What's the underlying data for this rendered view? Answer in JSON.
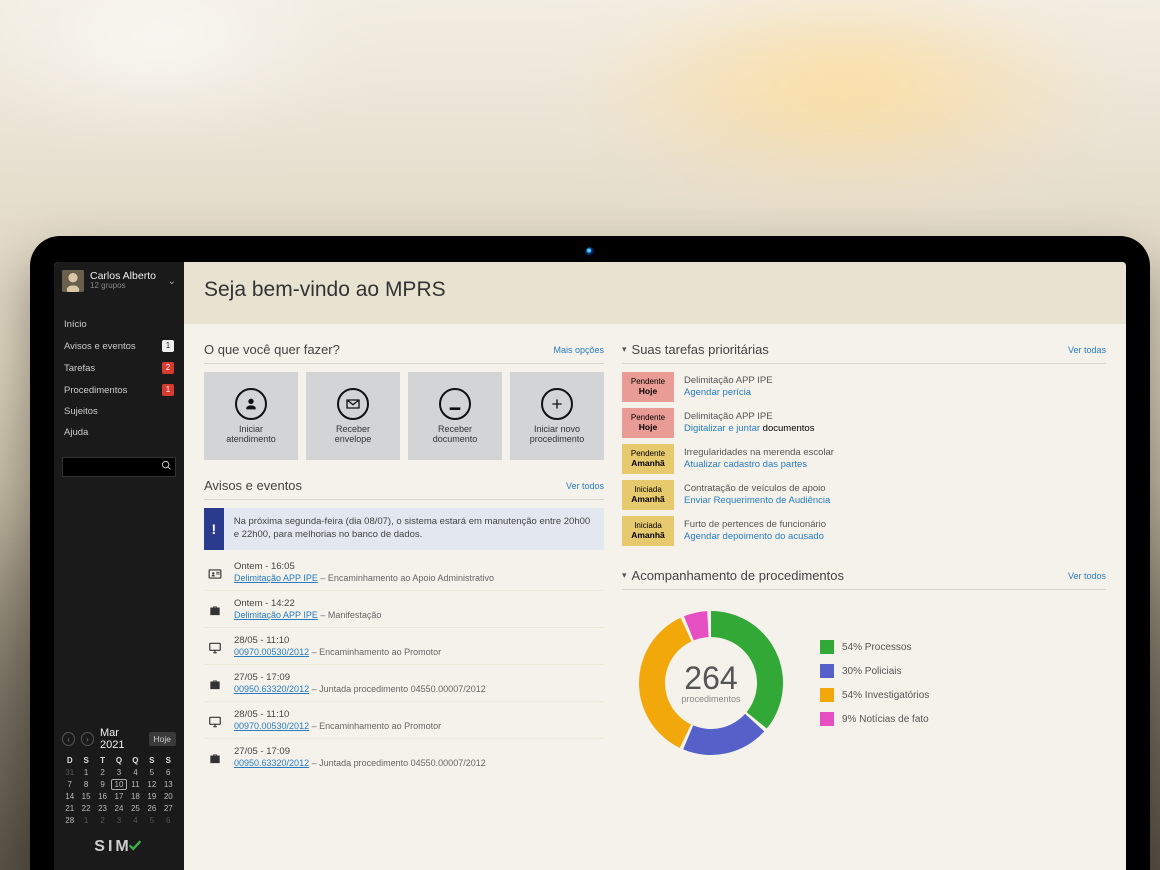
{
  "user": {
    "name": "Carlos Alberto",
    "subtitle": "12 grupos"
  },
  "nav": {
    "items": [
      {
        "label": "Início",
        "badge": "",
        "badge_class": ""
      },
      {
        "label": "Avisos e eventos",
        "badge": "1",
        "badge_class": "white"
      },
      {
        "label": "Tarefas",
        "badge": "2",
        "badge_class": "red"
      },
      {
        "label": "Procedimentos",
        "badge": "1",
        "badge_class": "red"
      },
      {
        "label": "Sujeitos",
        "badge": "",
        "badge_class": ""
      },
      {
        "label": "Ajuda",
        "badge": "",
        "badge_class": ""
      }
    ]
  },
  "search_placeholder": "",
  "calendar": {
    "title": "Mar 2021",
    "hoje": "Hoje",
    "weekdays": [
      "D",
      "S",
      "T",
      "Q",
      "Q",
      "S",
      "S"
    ],
    "leading_dim": [
      "31"
    ],
    "days": [
      "1",
      "2",
      "3",
      "4",
      "5",
      "6",
      "7",
      "8",
      "9",
      "10",
      "11",
      "12",
      "13",
      "14",
      "15",
      "16",
      "17",
      "18",
      "19",
      "20",
      "21",
      "22",
      "23",
      "24",
      "25",
      "26",
      "27",
      "28"
    ],
    "trailing_dim": [
      "1",
      "2",
      "3",
      "4",
      "5",
      "6"
    ],
    "today": "10"
  },
  "logo": "SIM",
  "page_title": "Seja bem-vindo ao MPRS",
  "quickactions": {
    "heading": "O que você quer fazer?",
    "more": "Mais opções",
    "tiles": [
      {
        "l1": "Iniciar",
        "l2": "atendimento"
      },
      {
        "l1": "Receber",
        "l2": "envelope"
      },
      {
        "l1": "Receber",
        "l2": "documento"
      },
      {
        "l1": "Iniciar novo",
        "l2": "procedimento"
      }
    ]
  },
  "avisos": {
    "heading": "Avisos e eventos",
    "more": "Ver todos",
    "notice": "Na próxima segunda-feira (dia 08/07), o sistema estará em manutenção entre 20h00 e 22h00, para melhorias no banco de dados.",
    "events": [
      {
        "icon": "id-card",
        "time": "Ontem - 16:05",
        "link": "Delimitação APP IPE",
        "suffix": " – Encaminhamento ao Apoio Administrativo"
      },
      {
        "icon": "briefcase",
        "time": "Ontem - 14:22",
        "link": "Delimitação APP IPE",
        "suffix": " – Manifestação"
      },
      {
        "icon": "monitor",
        "time": "28/05 - 11:10",
        "link": "00970.00530/2012",
        "suffix": " – Encaminhamento ao Promotor"
      },
      {
        "icon": "briefcase",
        "time": "27/05 - 17:09",
        "link": "00950.63320/2012",
        "suffix": " – Juntada procedimento 04550.00007/2012"
      },
      {
        "icon": "monitor",
        "time": "28/05 - 11:10",
        "link": "00970.00530/2012",
        "suffix": " – Encaminhamento ao Promotor"
      },
      {
        "icon": "briefcase",
        "time": "27/05 - 17:09",
        "link": "00950.63320/2012",
        "suffix": " – Juntada procedimento 04550.00007/2012"
      }
    ]
  },
  "tasks": {
    "heading": "Suas tarefas prioritárias",
    "more": "Ver todas",
    "items": [
      {
        "status": "Pendente",
        "when": "Hoje",
        "cls": "red",
        "title": "Delimitação APP IPE",
        "link": "Agendar perícia",
        "suffix": ""
      },
      {
        "status": "Pendente",
        "when": "Hoje",
        "cls": "red",
        "title": "Delimitação APP IPE",
        "link": "Digitalizar e juntar",
        "suffix": " documentos"
      },
      {
        "status": "Pendente",
        "when": "Amanhã",
        "cls": "yel",
        "title": "Irregularidades na merenda escolar",
        "link": "Atualizar cadastro das partes",
        "suffix": ""
      },
      {
        "status": "Iniciada",
        "when": "Amanhã",
        "cls": "yel",
        "title": "Contratação de veículos de apoio",
        "link": "Enviar Requerimento de Audiência",
        "suffix": ""
      },
      {
        "status": "Iniciada",
        "when": "Amanhã",
        "cls": "yel",
        "title": "Furto de pertences de funcionário",
        "link": "Agendar depoimento do acusado",
        "suffix": ""
      }
    ]
  },
  "procs": {
    "heading": "Acompanhamento de procedimentos",
    "more": "Ver todos",
    "center_num": "264",
    "center_lbl": "procedimentos",
    "legend": [
      {
        "color": "#32a836",
        "label": "54% Processos"
      },
      {
        "color": "#5560c9",
        "label": "30% Policiais"
      },
      {
        "color": "#f2a80b",
        "label": "54% Investigatórios"
      },
      {
        "color": "#e64fc1",
        "label": "9% Notícias de fato"
      }
    ]
  },
  "chart_data": {
    "type": "pie",
    "title": "Acompanhamento de procedimentos",
    "center_value": 264,
    "center_label": "procedimentos",
    "series": [
      {
        "name": "Processos",
        "value": 54,
        "color": "#32a836"
      },
      {
        "name": "Policiais",
        "value": 30,
        "color": "#5560c9"
      },
      {
        "name": "Investigatórios",
        "value": 54,
        "color": "#f2a80b"
      },
      {
        "name": "Notícias de fato",
        "value": 9,
        "color": "#e64fc1"
      }
    ],
    "note": "Percent labels shown in legend sum >100 as rendered in source image."
  }
}
